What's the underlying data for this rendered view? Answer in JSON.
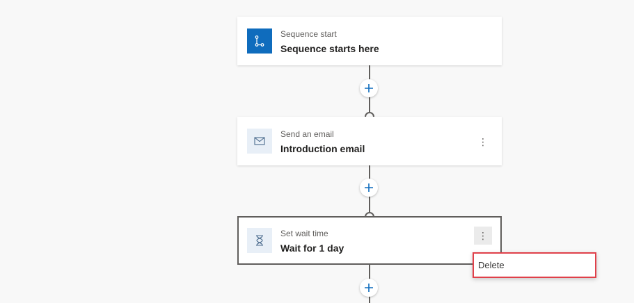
{
  "steps": [
    {
      "subtitle": "Sequence start",
      "title": "Sequence starts here",
      "icon": "branch-icon"
    },
    {
      "subtitle": "Send an email",
      "title": "Introduction email",
      "icon": "envelope-icon"
    },
    {
      "subtitle": "Set wait time",
      "title": "Wait for 1 day",
      "icon": "hourglass-icon"
    }
  ],
  "more_label": "⋮",
  "context_menu": {
    "items": [
      {
        "label": "Delete"
      }
    ]
  },
  "colors": {
    "accent": "#0f6cbd",
    "highlight": "#e0404a",
    "line": "#605e5c"
  }
}
